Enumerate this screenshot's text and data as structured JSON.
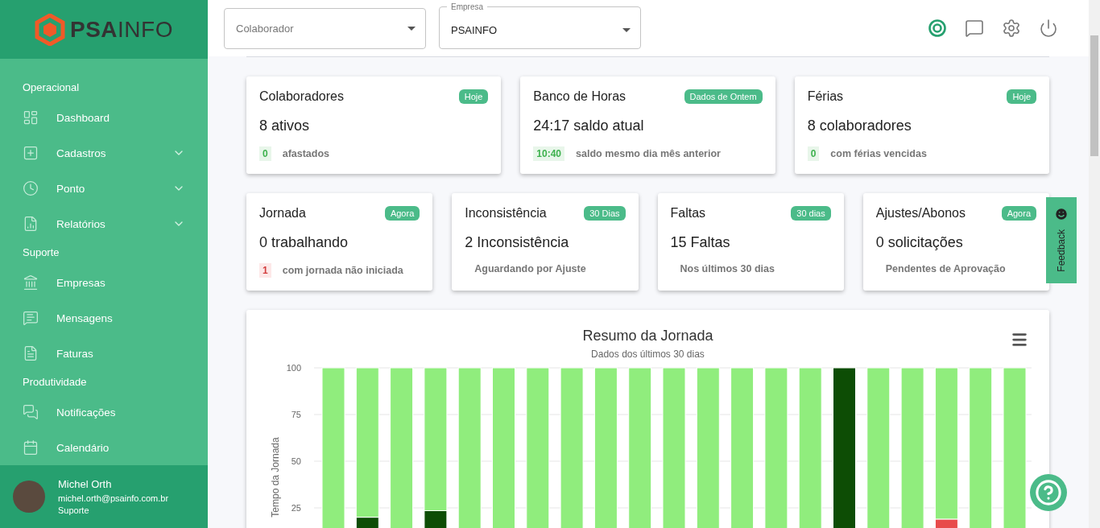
{
  "sidebar": {
    "logo": "**PSA**INFO",
    "sections": [
      {
        "title": "Operacional",
        "items": [
          {
            "label": "Dashboard",
            "expandable": false
          },
          {
            "label": "Cadastros",
            "expandable": true
          },
          {
            "label": "Ponto",
            "expandable": true
          },
          {
            "label": "Relatórios",
            "expandable": true
          }
        ]
      },
      {
        "title": "Suporte",
        "items": [
          {
            "label": "Empresas",
            "expandable": false
          },
          {
            "label": "Mensagens",
            "expandable": false
          },
          {
            "label": "Faturas",
            "expandable": false
          }
        ]
      },
      {
        "title": "Produtividade",
        "items": [
          {
            "label": "Notificações",
            "expandable": false
          },
          {
            "label": "Calendário",
            "expandable": false
          }
        ]
      }
    ],
    "user": {
      "name": "Michel Orth",
      "email": "michel.orth@psainfo.com.br",
      "role": "Suporte"
    }
  },
  "topbar": {
    "fields": [
      {
        "placeholder": "Colaborador"
      },
      {
        "label": "Empresa",
        "value": "PSAINFO"
      }
    ],
    "actions": [
      {
        "selected": true
      },
      {
        "selected": false
      },
      {
        "selected": false
      },
      {
        "selected": false
      }
    ]
  },
  "cards_row_1": [
    {
      "title": "Colaboradores",
      "badge": "Hoje",
      "value": "8 ativos",
      "count": "0",
      "kind": "positive",
      "note": "afastados"
    },
    {
      "title": "Banco de Horas",
      "badge": "Dados de Ontem",
      "value": "24:17 saldo atual",
      "count": "10:40",
      "kind": "positive",
      "note": "saldo mesmo dia mês anterior"
    },
    {
      "title": "Férias",
      "badge": "Hoje",
      "value": "8 colaboradores",
      "count": "0",
      "kind": "positive",
      "note": "com férias vencidas"
    }
  ],
  "cards_row_2": [
    {
      "title": "Jornada",
      "badge": "Agora",
      "value": "0 trabalhando",
      "count": "1",
      "kind": "negative",
      "note": "com jornada não iniciada"
    },
    {
      "title": "Inconsistência",
      "badge": "30 Dias",
      "value": "2 Inconsistência",
      "note": "Aguardando por Ajuste"
    },
    {
      "title": "Faltas",
      "badge": "30 dias",
      "value": "15 Faltas",
      "note": "Nos últimos 30 dias"
    },
    {
      "title": "Ajustes/Abonos",
      "badge": "Agora",
      "value": "0 solicitações",
      "note": "Pendentes de Aprovação"
    }
  ],
  "feedback": {
    "label": "Feedback"
  },
  "chart": {
    "subtitle": "Dados dos últimos 30 dias",
    "chart_data": {
      "type": "bar",
      "title": "Resumo da Jornada",
      "ylabel": "Tempo da Jornada",
      "stacked": true,
      "grid": true,
      "ylim": [
        0,
        100
      ],
      "yticks": [
        25,
        50,
        75,
        100
      ],
      "series": [
        {
          "color": "#0d4d05",
          "values": [
            0,
            20,
            0,
            23.5,
            0,
            0,
            0,
            0,
            0,
            0,
            0,
            0,
            0,
            0,
            0,
            100,
            0,
            0,
            0,
            0,
            0
          ]
        },
        {
          "color": "#e84b4b",
          "values": [
            0,
            0,
            0,
            0,
            0,
            0,
            0,
            0,
            0,
            0,
            0,
            0,
            0,
            0,
            0,
            0,
            0,
            0,
            19,
            0,
            0
          ]
        },
        {
          "color": "#90ed7d",
          "values": [
            100,
            80,
            100,
            76.5,
            100,
            100,
            100,
            100,
            100,
            100,
            100,
            100,
            100,
            100,
            100,
            0,
            100,
            100,
            81,
            100,
            100
          ]
        }
      ]
    }
  }
}
